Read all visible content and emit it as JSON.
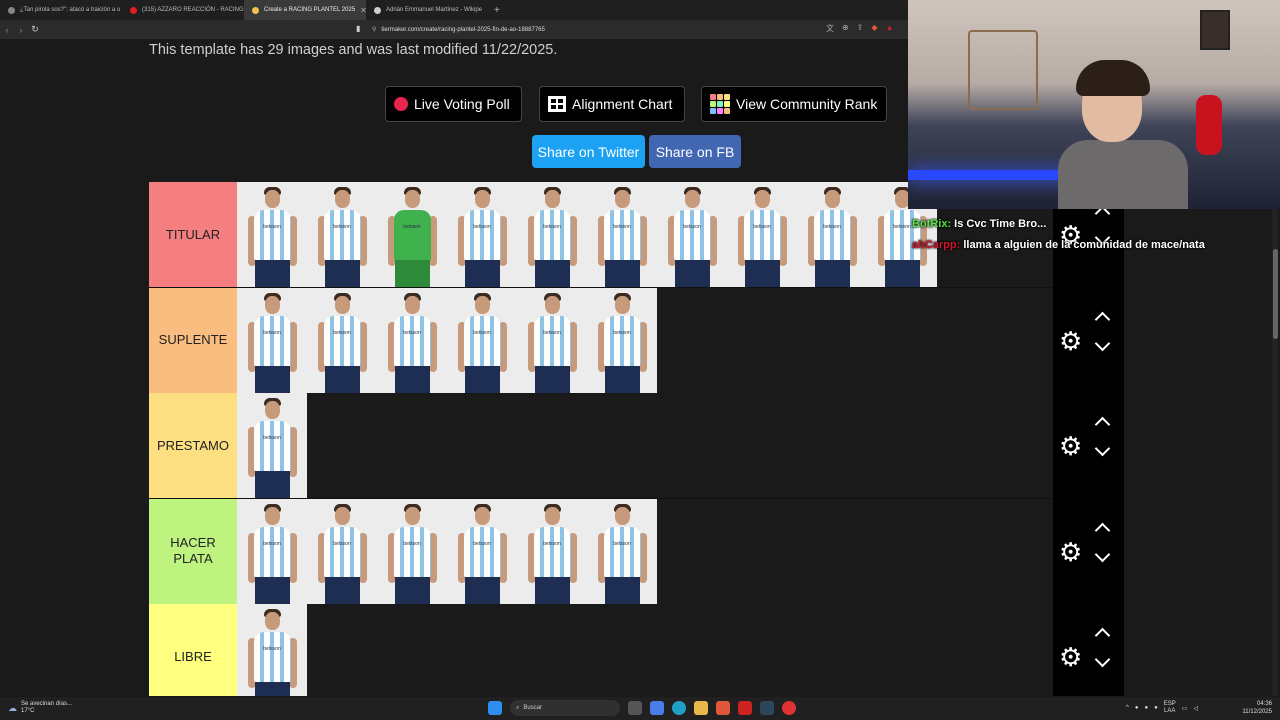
{
  "browser": {
    "tabs": [
      {
        "label": "¿Tan pirola sos?\": atacó a traición a u",
        "active": false,
        "color": "#888888"
      },
      {
        "label": "(315) AZZARO REACCIÓN - RACING",
        "active": false,
        "color": "#e02020"
      },
      {
        "label": "Create a RACING PLANTEL 2025",
        "active": true,
        "color": "#f2c14e"
      },
      {
        "label": "Adrián Emmanuel Martínez - Wikipe",
        "active": false,
        "color": "#cccccc"
      }
    ],
    "new_tab": "+",
    "url": "tiermaker.com/create/racing-plantel-2025-fin-de-ao-18887765"
  },
  "page": {
    "info_text": "This template has 29 images and was last modified 11/22/2025.",
    "buttons": {
      "live_voting": "Live Voting Poll",
      "alignment": "Alignment Chart",
      "community_rank": "View Community Rank",
      "share_twitter": "Share on Twitter",
      "share_fb": "Share on FB"
    },
    "tiers": [
      {
        "label": "TITULAR",
        "color": "#f47e80",
        "players": 10,
        "gk_index": 2
      },
      {
        "label": "SUPLENTE",
        "color": "#f8bd7f",
        "players": 6,
        "gk_index": -1
      },
      {
        "label": "PRESTAMO",
        "color": "#fbdf81",
        "players": 1,
        "gk_index": -1
      },
      {
        "label": "HACER PLATA",
        "color": "#bff380",
        "players": 6,
        "gk_index": -1
      },
      {
        "label": "LIBRE",
        "color": "#ffff7f",
        "players": 1,
        "gk_index": -1
      }
    ],
    "shirt_logo": "betsson"
  },
  "chat": [
    {
      "user": "BotRix:",
      "msg": "Is Cvc Time Bro..."
    },
    {
      "user": "ahCarpp:",
      "msg": "llama a alguien de la comunidad de mace/nata"
    }
  ],
  "taskbar": {
    "weather_title": "Se avecinan días...",
    "weather_temp": "17°C",
    "search": "Buscar",
    "lang": "ESP",
    "lang2": "LAA",
    "time": "04:36",
    "date": "11/12/2025"
  }
}
